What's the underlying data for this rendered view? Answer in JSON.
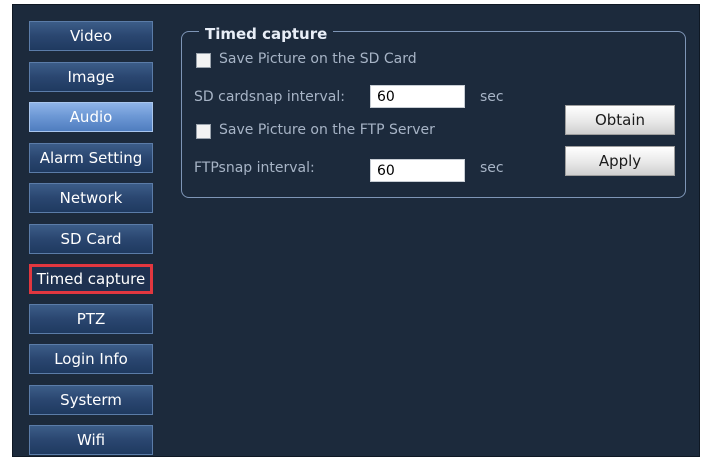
{
  "sidebar": {
    "items": [
      {
        "label": "Video"
      },
      {
        "label": "Image"
      },
      {
        "label": "Audio"
      },
      {
        "label": "Alarm Setting"
      },
      {
        "label": "Network"
      },
      {
        "label": "SD Card"
      },
      {
        "label": "Timed capture"
      },
      {
        "label": "PTZ"
      },
      {
        "label": "Login Info"
      },
      {
        "label": "Systerm"
      },
      {
        "label": "Wifi"
      }
    ],
    "active_item": "Timed capture",
    "active_highlight_color": "#e2373f"
  },
  "timed_capture": {
    "title": "Timed capture",
    "sd_card": {
      "checkbox_label": "Save Picture on the SD Card",
      "checked": false,
      "interval_label": "SD cardsnap interval:",
      "interval_value": "60",
      "unit": "sec"
    },
    "ftp": {
      "checkbox_label": "Save Picture on the FTP Server",
      "checked": false,
      "interval_label": "FTPsnap interval:",
      "interval_value": "60",
      "unit": "sec"
    },
    "obtain_label": "Obtain",
    "apply_label": "Apply"
  }
}
